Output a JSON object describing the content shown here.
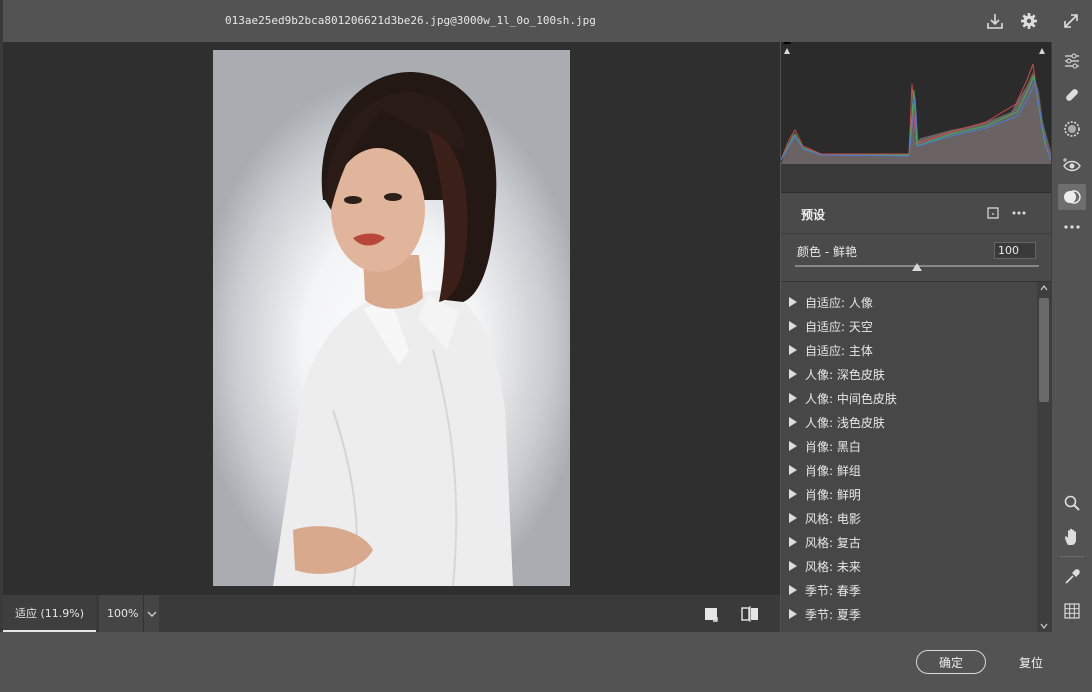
{
  "window": {
    "file_name": "013ae25ed9b2bca801206621d3be26.jpg@3000w_1l_0o_100sh.jpg"
  },
  "top_icons": [
    "download-icon",
    "gear-icon",
    "expand-icon"
  ],
  "presets": {
    "title": "预设",
    "amount_label": "颜色 - 鲜艳",
    "amount_value": "100",
    "amount_fraction": 0.5,
    "items": [
      "自适应: 人像",
      "自适应: 天空",
      "自适应: 主体",
      "人像: 深色皮肤",
      "人像: 中间色皮肤",
      "人像: 浅色皮肤",
      "肖像: 黑白",
      "肖像: 鲜组",
      "肖像: 鲜明",
      "风格: 电影",
      "风格: 复古",
      "风格: 未来",
      "季节: 春季",
      "季节: 夏季"
    ]
  },
  "zoom": {
    "fit_label": "适应 (11.9%)",
    "percent_label": "100%"
  },
  "footer": {
    "ok_label": "确定",
    "reset_label": "复位"
  },
  "tools": [
    "sliders-icon",
    "healing-brush-icon",
    "mask-icon",
    "red-eye-icon",
    "presets-icon",
    "more-icon",
    "zoom-icon",
    "hand-icon",
    "eyedropper-icon",
    "grid-icon"
  ],
  "colors": {
    "panel": "#535353",
    "canvas": "#2f2f2f",
    "accent": "#e6e6e6"
  }
}
